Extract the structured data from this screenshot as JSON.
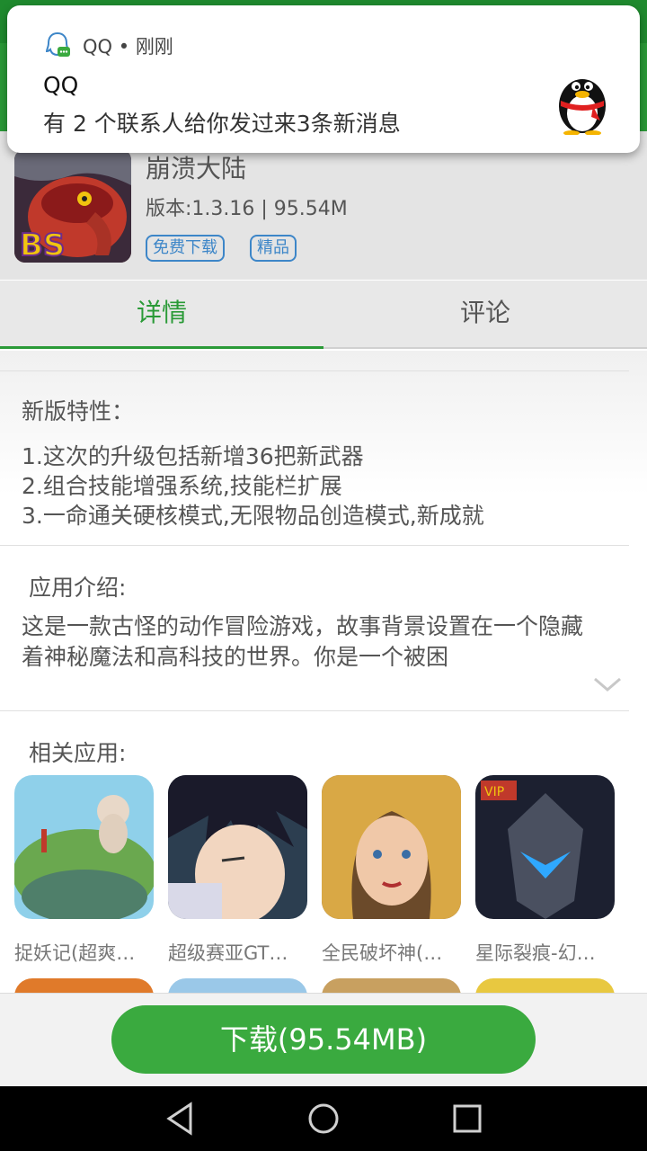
{
  "notification": {
    "app": "QQ",
    "time": "刚刚",
    "title": "QQ",
    "body": "有 2 个联系人给你发过来3条新消息"
  },
  "app": {
    "name": "崩溃大陆",
    "meta": "版本:1.3.16 | 95.54M",
    "tags": [
      "免费下载",
      "精品"
    ]
  },
  "tabs": [
    {
      "label": "详情",
      "active": true
    },
    {
      "label": "评论",
      "active": false
    }
  ],
  "features": {
    "title": "新版特性：",
    "lines": [
      "1.这次的升级包括新增36把新武器",
      "2.组合技能增强系统,技能栏扩展",
      "3.一命通关硬核模式,无限物品创造模式,新成就"
    ]
  },
  "intro": {
    "title": "应用介绍:",
    "text": "这是一款古怪的动作冒险游戏，故事背景设置在一个隐藏着神秘魔法和高科技的世界。你是一个被困"
  },
  "related": {
    "title": "相关应用:",
    "items": [
      {
        "label": "捉妖记(超爽…"
      },
      {
        "label": "超级赛亚GT…"
      },
      {
        "label": "全民破坏神(…"
      },
      {
        "label": "星际裂痕-幻…"
      }
    ]
  },
  "download": {
    "label": "下载(95.54MB)"
  },
  "colors": {
    "accent": "#2a9a37",
    "button": "#3aaa3f",
    "tag": "#3d86c8"
  }
}
